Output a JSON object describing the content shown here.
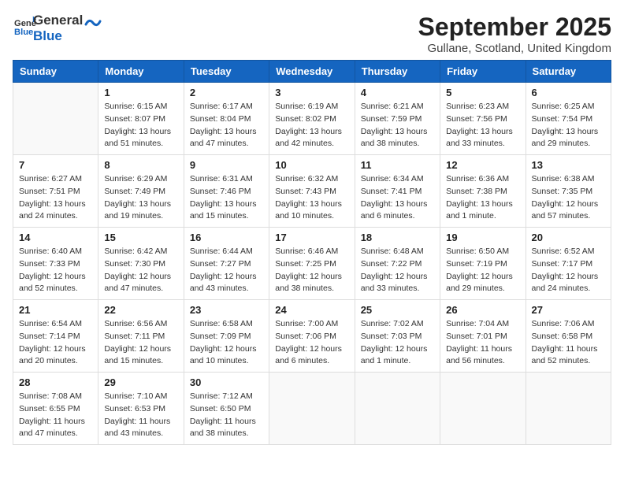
{
  "header": {
    "logo_general": "General",
    "logo_blue": "Blue",
    "month_title": "September 2025",
    "location": "Gullane, Scotland, United Kingdom"
  },
  "days_of_week": [
    "Sunday",
    "Monday",
    "Tuesday",
    "Wednesday",
    "Thursday",
    "Friday",
    "Saturday"
  ],
  "weeks": [
    [
      {
        "day": "",
        "info": ""
      },
      {
        "day": "1",
        "info": "Sunrise: 6:15 AM\nSunset: 8:07 PM\nDaylight: 13 hours and 51 minutes."
      },
      {
        "day": "2",
        "info": "Sunrise: 6:17 AM\nSunset: 8:04 PM\nDaylight: 13 hours and 47 minutes."
      },
      {
        "day": "3",
        "info": "Sunrise: 6:19 AM\nSunset: 8:02 PM\nDaylight: 13 hours and 42 minutes."
      },
      {
        "day": "4",
        "info": "Sunrise: 6:21 AM\nSunset: 7:59 PM\nDaylight: 13 hours and 38 minutes."
      },
      {
        "day": "5",
        "info": "Sunrise: 6:23 AM\nSunset: 7:56 PM\nDaylight: 13 hours and 33 minutes."
      },
      {
        "day": "6",
        "info": "Sunrise: 6:25 AM\nSunset: 7:54 PM\nDaylight: 13 hours and 29 minutes."
      }
    ],
    [
      {
        "day": "7",
        "info": "Sunrise: 6:27 AM\nSunset: 7:51 PM\nDaylight: 13 hours and 24 minutes."
      },
      {
        "day": "8",
        "info": "Sunrise: 6:29 AM\nSunset: 7:49 PM\nDaylight: 13 hours and 19 minutes."
      },
      {
        "day": "9",
        "info": "Sunrise: 6:31 AM\nSunset: 7:46 PM\nDaylight: 13 hours and 15 minutes."
      },
      {
        "day": "10",
        "info": "Sunrise: 6:32 AM\nSunset: 7:43 PM\nDaylight: 13 hours and 10 minutes."
      },
      {
        "day": "11",
        "info": "Sunrise: 6:34 AM\nSunset: 7:41 PM\nDaylight: 13 hours and 6 minutes."
      },
      {
        "day": "12",
        "info": "Sunrise: 6:36 AM\nSunset: 7:38 PM\nDaylight: 13 hours and 1 minute."
      },
      {
        "day": "13",
        "info": "Sunrise: 6:38 AM\nSunset: 7:35 PM\nDaylight: 12 hours and 57 minutes."
      }
    ],
    [
      {
        "day": "14",
        "info": "Sunrise: 6:40 AM\nSunset: 7:33 PM\nDaylight: 12 hours and 52 minutes."
      },
      {
        "day": "15",
        "info": "Sunrise: 6:42 AM\nSunset: 7:30 PM\nDaylight: 12 hours and 47 minutes."
      },
      {
        "day": "16",
        "info": "Sunrise: 6:44 AM\nSunset: 7:27 PM\nDaylight: 12 hours and 43 minutes."
      },
      {
        "day": "17",
        "info": "Sunrise: 6:46 AM\nSunset: 7:25 PM\nDaylight: 12 hours and 38 minutes."
      },
      {
        "day": "18",
        "info": "Sunrise: 6:48 AM\nSunset: 7:22 PM\nDaylight: 12 hours and 33 minutes."
      },
      {
        "day": "19",
        "info": "Sunrise: 6:50 AM\nSunset: 7:19 PM\nDaylight: 12 hours and 29 minutes."
      },
      {
        "day": "20",
        "info": "Sunrise: 6:52 AM\nSunset: 7:17 PM\nDaylight: 12 hours and 24 minutes."
      }
    ],
    [
      {
        "day": "21",
        "info": "Sunrise: 6:54 AM\nSunset: 7:14 PM\nDaylight: 12 hours and 20 minutes."
      },
      {
        "day": "22",
        "info": "Sunrise: 6:56 AM\nSunset: 7:11 PM\nDaylight: 12 hours and 15 minutes."
      },
      {
        "day": "23",
        "info": "Sunrise: 6:58 AM\nSunset: 7:09 PM\nDaylight: 12 hours and 10 minutes."
      },
      {
        "day": "24",
        "info": "Sunrise: 7:00 AM\nSunset: 7:06 PM\nDaylight: 12 hours and 6 minutes."
      },
      {
        "day": "25",
        "info": "Sunrise: 7:02 AM\nSunset: 7:03 PM\nDaylight: 12 hours and 1 minute."
      },
      {
        "day": "26",
        "info": "Sunrise: 7:04 AM\nSunset: 7:01 PM\nDaylight: 11 hours and 56 minutes."
      },
      {
        "day": "27",
        "info": "Sunrise: 7:06 AM\nSunset: 6:58 PM\nDaylight: 11 hours and 52 minutes."
      }
    ],
    [
      {
        "day": "28",
        "info": "Sunrise: 7:08 AM\nSunset: 6:55 PM\nDaylight: 11 hours and 47 minutes."
      },
      {
        "day": "29",
        "info": "Sunrise: 7:10 AM\nSunset: 6:53 PM\nDaylight: 11 hours and 43 minutes."
      },
      {
        "day": "30",
        "info": "Sunrise: 7:12 AM\nSunset: 6:50 PM\nDaylight: 11 hours and 38 minutes."
      },
      {
        "day": "",
        "info": ""
      },
      {
        "day": "",
        "info": ""
      },
      {
        "day": "",
        "info": ""
      },
      {
        "day": "",
        "info": ""
      }
    ]
  ]
}
